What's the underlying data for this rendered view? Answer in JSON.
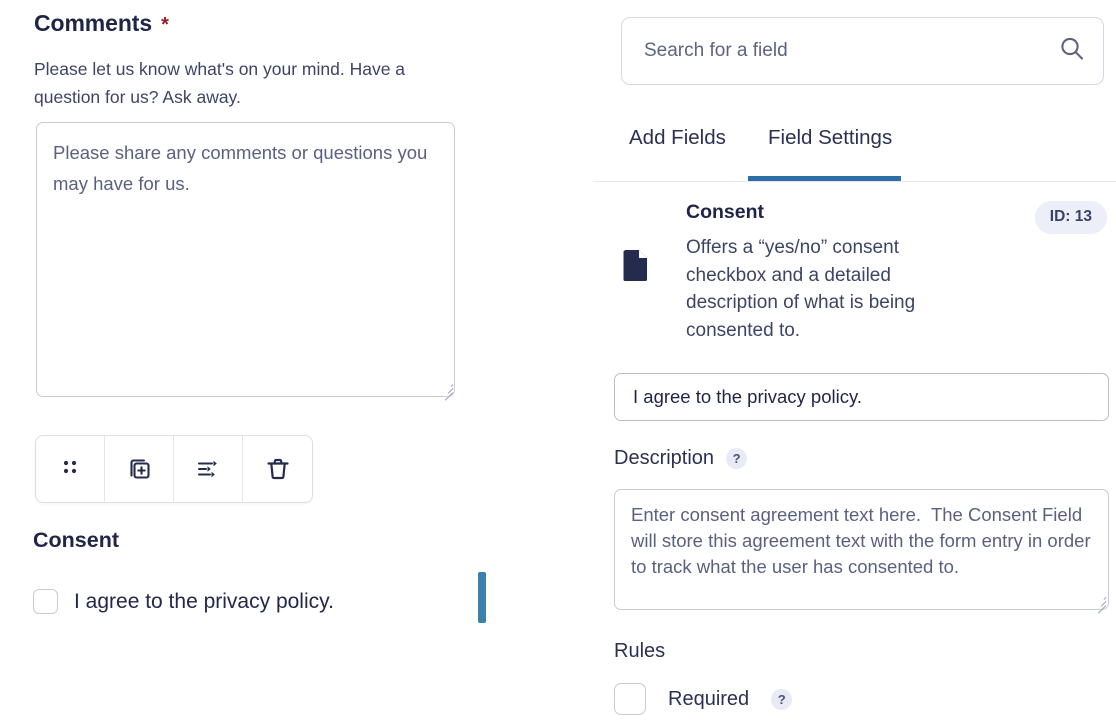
{
  "left_panel": {
    "field_label": "Comments",
    "required_marker": "*",
    "field_description": "Please let us know what's on your mind. Have a question for us? Ask away.",
    "comment_placeholder": "Please share any comments or questions you may have for us.",
    "comment_value": "",
    "toolbar": [
      {
        "name": "drag-handle",
        "label": "Drag"
      },
      {
        "name": "duplicate",
        "label": "Duplicate"
      },
      {
        "name": "settings",
        "label": "Settings"
      },
      {
        "name": "delete",
        "label": "Delete"
      }
    ],
    "consent_heading": "Consent",
    "consent_checkbox_label": "I agree to the privacy policy.",
    "consent_checked": false
  },
  "right_panel": {
    "search": {
      "placeholder": "Search for a field",
      "value": "",
      "icon": "search-icon"
    },
    "tabs": [
      {
        "label": "Add Fields",
        "active": false
      },
      {
        "label": "Field Settings",
        "active": true
      }
    ],
    "field_card": {
      "icon": "document-icon",
      "title": "Consent",
      "description": "Offers a “yes/no” consent checkbox and a detailed description of what is being consented to.",
      "id_badge": "ID: 13"
    },
    "label_field": {
      "value": "I agree to the privacy policy."
    },
    "description_field": {
      "label": "Description",
      "help": "?",
      "placeholder": "Enter consent agreement text here.  The Consent Field will store this agreement text with the form entry in order to track what the user has consented to.",
      "value": ""
    },
    "rules": {
      "label": "Rules",
      "items": [
        {
          "label": "Required",
          "help": "?",
          "checked": false
        }
      ]
    }
  },
  "colors": {
    "accent_blue": "#2c6ea5",
    "caret_blue": "#3d80ab",
    "ink": "#1f2547",
    "muted": "#5a6180",
    "required_red": "#9b1c2e",
    "badge_bg": "#eceef8",
    "border": "#c9cbdb"
  }
}
